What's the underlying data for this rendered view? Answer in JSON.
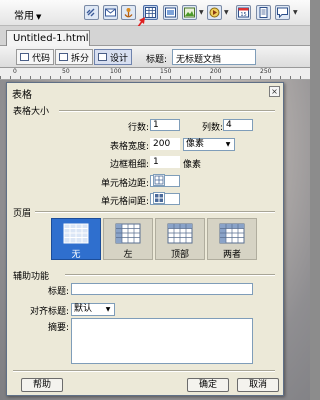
{
  "toolbar": {
    "menu_label": "常用",
    "icons": [
      "link-icon",
      "email-icon",
      "anchor-icon",
      "table-icon",
      "layer-icon",
      "image-icon",
      "media-icon",
      "date-icon",
      "server-include-icon",
      "comment-icon"
    ]
  },
  "document": {
    "tab_title": "Untitled-1.html"
  },
  "doc_toolbar": {
    "code_label": "代码",
    "split_label": "拆分",
    "design_label": "设计",
    "title_label": "标题:",
    "title_value": "无标题文档"
  },
  "ruler": {
    "ticks": [
      "0",
      "50",
      "100",
      "150",
      "200",
      "250"
    ]
  },
  "dialog": {
    "title": "表格",
    "close": "×",
    "size_section": "表格大小",
    "rows_label": "行数:",
    "rows_value": "1",
    "cols_label": "列数:",
    "cols_value": "4",
    "width_label": "表格宽度:",
    "width_value": "200",
    "width_unit": "像素",
    "border_label": "边框粗细:",
    "border_value": "1",
    "border_unit": "像素",
    "padding_label": "单元格边距:",
    "padding_value": "",
    "spacing_label": "单元格间距:",
    "spacing_value": "",
    "header_section": "页眉",
    "header_options": [
      {
        "label": "无",
        "selected": true
      },
      {
        "label": "左",
        "selected": false
      },
      {
        "label": "顶部",
        "selected": false
      },
      {
        "label": "两者",
        "selected": false
      }
    ],
    "access_section": "辅助功能",
    "caption_label": "标题:",
    "caption_value": "",
    "align_label": "对齐标题:",
    "align_value": "默认",
    "summary_label": "摘要:",
    "summary_value": "",
    "help_button": "帮助",
    "ok_button": "确定",
    "cancel_button": "取消"
  },
  "colors": {
    "accent": "#2f6fce",
    "dialog_bg": "#ece9d8",
    "arrow": "#e02020"
  }
}
